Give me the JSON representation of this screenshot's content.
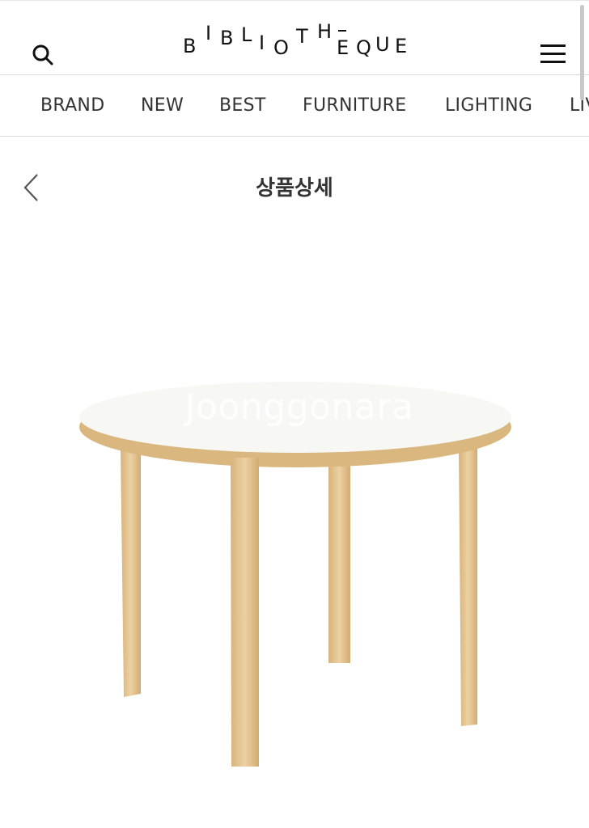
{
  "header": {
    "logo_letters": [
      "B",
      "I",
      "B",
      "L",
      "I",
      "O",
      "T",
      "H",
      "E",
      "Q",
      "U",
      "E"
    ],
    "search_icon": "search-icon",
    "menu_icon": "hamburger-menu-icon"
  },
  "nav": {
    "items": [
      "BRAND",
      "NEW",
      "BEST",
      "FURNITURE",
      "LIGHTING",
      "LIVING"
    ]
  },
  "subheader": {
    "back_icon": "chevron-left-icon",
    "title": "상품상세"
  },
  "product": {
    "watermark": "Joonggonara"
  },
  "colors": {
    "wood": "#e2c28f",
    "table_top": "#f7f7f4",
    "text": "#333333",
    "divider": "#d9d9d9"
  }
}
